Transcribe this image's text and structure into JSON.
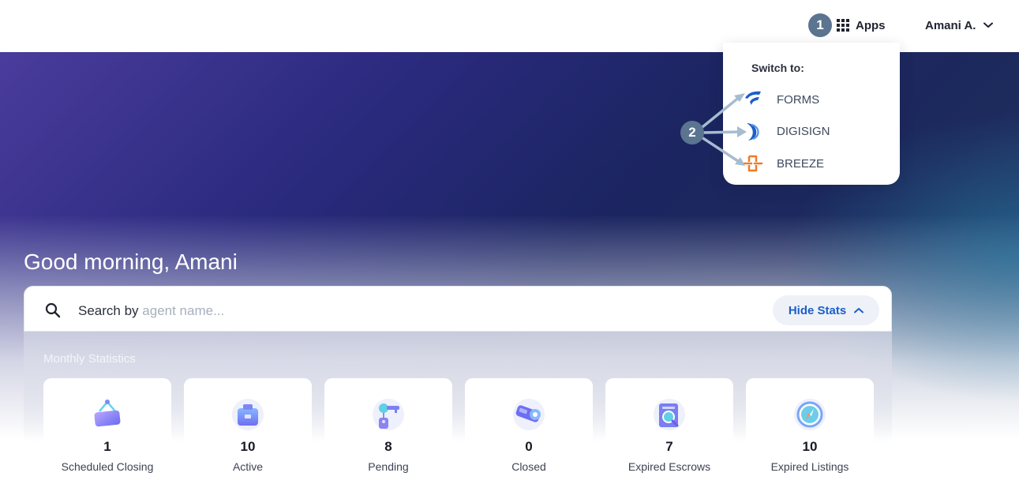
{
  "header": {
    "step_one": "1",
    "apps_label": "Apps",
    "user_name": "Amani A."
  },
  "apps_menu": {
    "step_two": "2",
    "switch_label": "Switch to:",
    "items": [
      {
        "label": "FORMS",
        "icon": "forms-logo-icon"
      },
      {
        "label": "DIGISIGN",
        "icon": "digisign-logo-icon"
      },
      {
        "label": "BREEZE",
        "icon": "breeze-logo-icon"
      }
    ]
  },
  "hero": {
    "greeting": "Good morning, Amani"
  },
  "search": {
    "prefix": "Search by",
    "hint": "agent name...",
    "hide_stats_label": "Hide Stats"
  },
  "stats": {
    "title": "Monthly Statistics",
    "cards": [
      {
        "value": "1",
        "label": "Scheduled Closing",
        "icon": "hanging-sign-icon"
      },
      {
        "value": "10",
        "label": "Active",
        "icon": "briefcase-icon"
      },
      {
        "value": "8",
        "label": "Pending",
        "icon": "key-tag-icon"
      },
      {
        "value": "0",
        "label": "Closed",
        "icon": "tape-icon"
      },
      {
        "value": "7",
        "label": "Expired Escrows",
        "icon": "document-search-icon"
      },
      {
        "value": "10",
        "label": "Expired Listings",
        "icon": "compass-icon"
      }
    ]
  },
  "colors": {
    "accent": "#1d5fc6",
    "badge": "#5b7490",
    "breeze": "#f07a2a"
  }
}
